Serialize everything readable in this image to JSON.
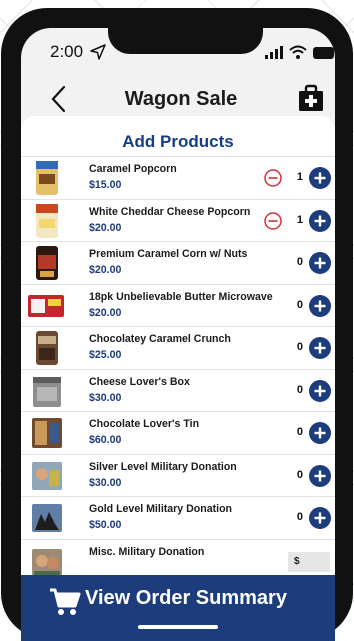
{
  "status": {
    "time": "2:00"
  },
  "header": {
    "title": "Wagon Sale"
  },
  "section": {
    "title": "Add Products"
  },
  "products": [
    {
      "name": "Caramel Popcorn",
      "price": "$15.00",
      "qty": "1"
    },
    {
      "name": "White Cheddar Cheese Popcorn",
      "price": "$20.00",
      "qty": "1"
    },
    {
      "name": "Premium Caramel Corn w/ Nuts",
      "price": "$20.00",
      "qty": "0"
    },
    {
      "name": "18pk Unbelievable Butter Microwave",
      "price": "$20.00",
      "qty": "0"
    },
    {
      "name": "Chocolatey Caramel Crunch",
      "price": "$25.00",
      "qty": "0"
    },
    {
      "name": "Cheese Lover's Box",
      "price": "$30.00",
      "qty": "0"
    },
    {
      "name": "Chocolate Lover's Tin",
      "price": "$60.00",
      "qty": "0"
    },
    {
      "name": "Silver Level Military Donation",
      "price": "$30.00",
      "qty": "0"
    },
    {
      "name": "Gold Level Military Donation",
      "price": "$50.00",
      "qty": "0"
    },
    {
      "name": "Misc. Military Donation",
      "amount_prefix": "$"
    }
  ],
  "footer": {
    "button_label": "View Order Summary"
  },
  "colors": {
    "brand_blue": "#1d3c7c",
    "minus_red": "#d32f3a"
  },
  "icons": [
    "back-chevron-icon",
    "shopping-bag-plus-icon",
    "minus-circle-icon",
    "plus-circle-icon",
    "cart-icon",
    "wifi-icon",
    "signal-icon",
    "battery-icon",
    "location-arrow-icon"
  ]
}
